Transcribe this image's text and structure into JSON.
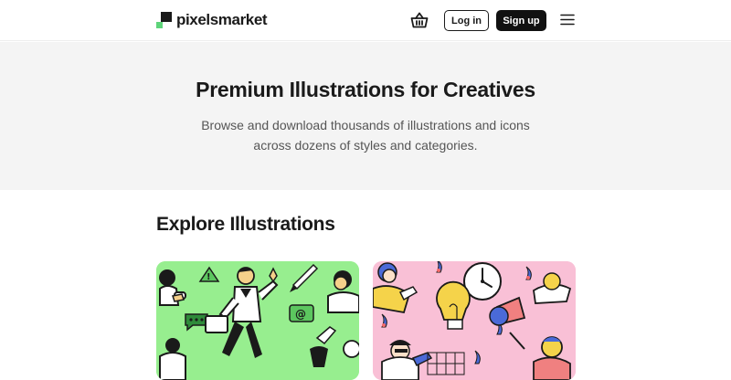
{
  "header": {
    "logo_text": "pixelsmarket",
    "login_label": "Log in",
    "signup_label": "Sign up",
    "basket_icon": "basket-icon",
    "menu_icon": "hamburger-menu-icon"
  },
  "hero": {
    "title": "Premium Illustrations for Creatives",
    "subtitle": "Browse and download thousands of illustrations and icons across dozens of styles and categories."
  },
  "explore": {
    "title": "Explore Illustrations",
    "cards": [
      {
        "background": "#97ee8f"
      },
      {
        "background": "#f9c0d6"
      }
    ]
  },
  "colors": {
    "brand_dark": "#111111",
    "brand_green": "#5ed47a",
    "hero_bg": "#f4f4f4"
  }
}
